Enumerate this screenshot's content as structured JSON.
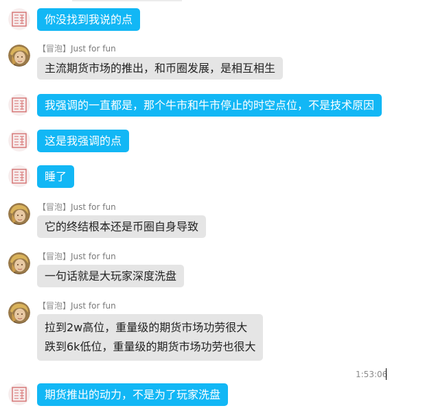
{
  "conversation": {
    "messages": [
      {
        "side": "me",
        "text": "你没找到我说的点"
      },
      {
        "side": "other",
        "sender_tag": "【冒泡】",
        "sender_name": "Just for fun",
        "text": "主流期货市场的推出，和币圈发展，是相互相生"
      },
      {
        "side": "me",
        "text": "我强调的一直都是，那个牛市和牛市停止的时空点位，不是技术原因"
      },
      {
        "side": "me",
        "text": "这是我强调的点"
      },
      {
        "side": "me",
        "text": "睡了"
      },
      {
        "side": "other",
        "sender_tag": "【冒泡】",
        "sender_name": "Just for fun",
        "text": "它的终结根本还是币圈自身导致"
      },
      {
        "side": "other",
        "sender_tag": "【冒泡】",
        "sender_name": "Just for fun",
        "text": "一句话就是大玩家深度洗盘"
      },
      {
        "side": "other",
        "sender_tag": "【冒泡】",
        "sender_name": "Just for fun",
        "lines": [
          "拉到2w高位，重量级的期货市场功劳很大",
          "跌到6k低位，重量级的期货市场功劳也很大"
        ]
      },
      {
        "side": "me",
        "text": "期货推出的动力，不是为了玩家洗盘"
      }
    ],
    "timestamp": "1:53:06"
  },
  "icons": {
    "my_avatar": "seal-avatar-icon",
    "other_avatar": "character-avatar-icon"
  },
  "colors": {
    "my_bubble": "#12b7f5",
    "other_bubble": "#e5e5e5",
    "my_text": "#ffffff",
    "other_text": "#222222",
    "sender_text": "#7a7a7a"
  }
}
